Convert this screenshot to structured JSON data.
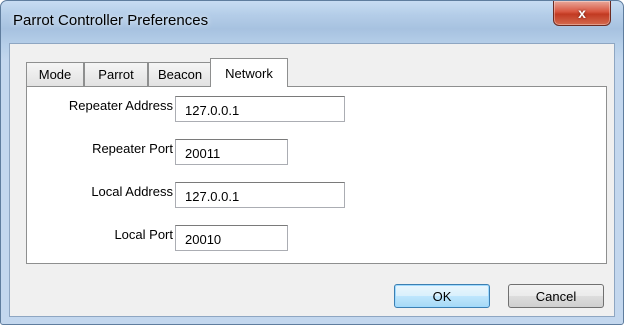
{
  "window": {
    "title": "Parrot Controller Preferences",
    "close_glyph": "x"
  },
  "tabs": [
    {
      "label": "Mode"
    },
    {
      "label": "Parrot"
    },
    {
      "label": "Beacon"
    },
    {
      "label": "Network",
      "active": true
    }
  ],
  "network": {
    "repeater_address_label": "Repeater Address",
    "repeater_address_value": "127.0.0.1",
    "repeater_port_label": "Repeater Port",
    "repeater_port_value": "20011",
    "local_address_label": "Local Address",
    "local_address_value": "127.0.0.1",
    "local_port_label": "Local Port",
    "local_port_value": "20010"
  },
  "buttons": {
    "ok": "OK",
    "cancel": "Cancel"
  },
  "colors": {
    "title_bar": "#b6cfe9",
    "close_button": "#c23a22",
    "default_button_border": "#3c7fb1"
  }
}
